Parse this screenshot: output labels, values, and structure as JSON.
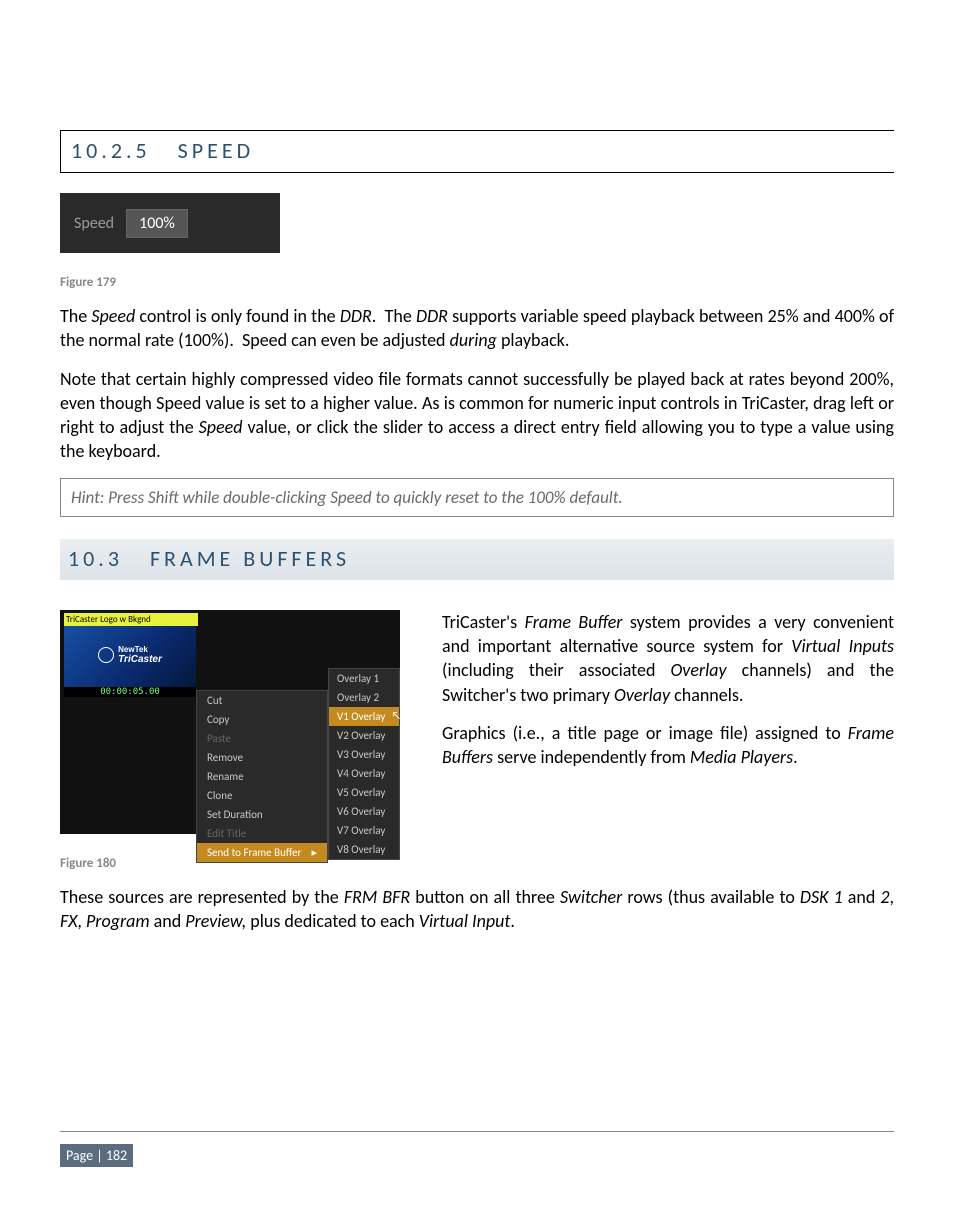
{
  "section_speed": {
    "number": "10.2.5",
    "title": "SPEED"
  },
  "speed_widget": {
    "label": "Speed",
    "value": "100%"
  },
  "fig179": "Figure 179",
  "para1": "The Speed control is only found in the DDR.  The DDR supports variable speed playback between 25% and 400% of the normal rate (100%).  Speed can even be adjusted during playback.",
  "para2": "Note that certain highly compressed video file formats cannot successfully be played back at rates beyond 200%, even though Speed value is set to a higher value. As is common for numeric input controls in TriCaster, drag left or right to adjust the Speed value, or click the slider to access a direct entry field allowing you to type a value using the keyboard.",
  "hint": "Hint: Press Shift while double-clicking Speed to quickly reset to the 100% default.",
  "section_fb": {
    "number": "10.3",
    "title": "FRAME BUFFERS"
  },
  "thumb": {
    "title": "TriCaster Logo w Bkgnd",
    "logo_top": "NewTek",
    "logo_bottom": "TriCaster",
    "timecode": "00:00:05.00"
  },
  "context_menu": {
    "items": [
      {
        "label": "Cut",
        "disabled": false
      },
      {
        "label": "Copy",
        "disabled": false
      },
      {
        "label": "Paste",
        "disabled": true
      },
      {
        "label": "Remove",
        "disabled": false
      },
      {
        "label": "Rename",
        "disabled": false
      },
      {
        "label": "Clone",
        "disabled": false
      },
      {
        "label": "Set Duration",
        "disabled": false
      },
      {
        "label": "Edit Title",
        "disabled": true
      }
    ],
    "selected": {
      "label": "Send to Frame Buffer",
      "arrow": "▸"
    }
  },
  "sub_menu": {
    "items": [
      "Overlay 1",
      "Overlay 2"
    ],
    "selected": "V1 Overlay",
    "rest": [
      "V2 Overlay",
      "V3 Overlay",
      "V4 Overlay",
      "V5 Overlay",
      "V6 Overlay",
      "V7 Overlay",
      "V8 Overlay"
    ]
  },
  "fb_para1": "TriCaster's Frame Buffer system provides a very convenient and important alternative source system for Virtual Inputs (including their associated Overlay channels) and the Switcher's two primary Overlay channels.",
  "fb_para2": "Graphics (i.e., a title page or image file) assigned to Frame Buffers serve independently from Media Players.",
  "fig180": "Figure 180",
  "para_after": "These sources are represented by the FRM BFR button on all three Switcher rows (thus available to DSK 1 and 2, FX, Program and Preview, plus dedicated to each Virtual Input.",
  "page_footer": "Page | 182"
}
